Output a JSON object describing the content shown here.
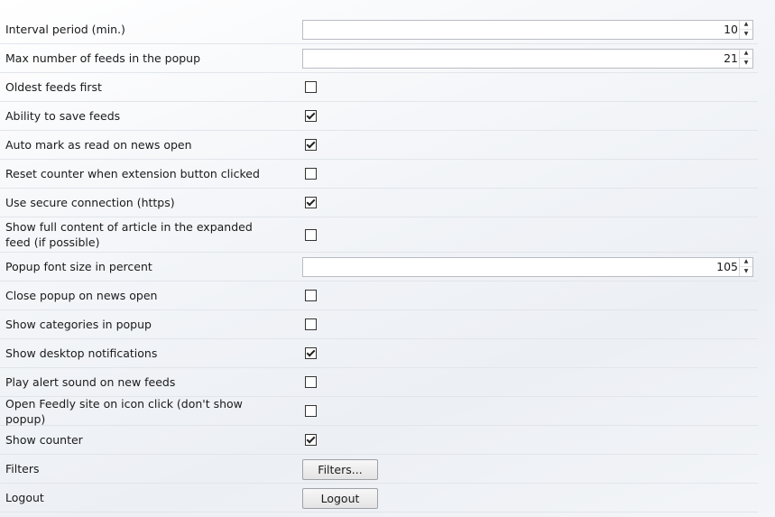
{
  "settings": {
    "interval_period": {
      "label": "Interval period (min.)",
      "value": "10"
    },
    "max_feeds": {
      "label": "Max number of feeds in the popup",
      "value": "21"
    },
    "oldest_first": {
      "label": "Oldest feeds first",
      "checked": false
    },
    "save_feeds": {
      "label": "Ability to save feeds",
      "checked": true
    },
    "auto_mark_read": {
      "label": "Auto mark as read on news open",
      "checked": true
    },
    "reset_counter": {
      "label": "Reset counter when extension button clicked",
      "checked": false
    },
    "secure_connection": {
      "label": "Use secure connection (https)",
      "checked": true
    },
    "full_content": {
      "label": "Show full content of article in the expanded feed (if possible)",
      "checked": false
    },
    "popup_font_size": {
      "label": "Popup font size in percent",
      "value": "105"
    },
    "close_popup": {
      "label": "Close popup on news open",
      "checked": false
    },
    "show_categories": {
      "label": "Show categories in popup",
      "checked": false
    },
    "desktop_notifications": {
      "label": "Show desktop notifications",
      "checked": true
    },
    "alert_sound": {
      "label": "Play alert sound on new feeds",
      "checked": false
    },
    "open_feedly_site": {
      "label": "Open Feedly site on icon click (don't show popup)",
      "checked": false
    },
    "show_counter": {
      "label": "Show counter",
      "checked": true
    },
    "filters": {
      "label": "Filters",
      "button_label": "Filters..."
    },
    "logout": {
      "label": "Logout",
      "button_label": "Logout"
    }
  },
  "icons": {
    "spin_up": "▲",
    "spin_down": "▼"
  }
}
